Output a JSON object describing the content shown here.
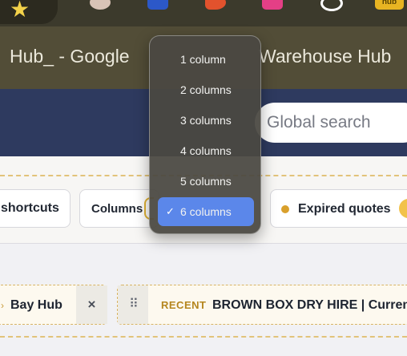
{
  "toolbar": {
    "bookmark_icon": "star-icon",
    "extensions": [
      "avatar-icon",
      "puzzle-icon",
      "rocket-icon",
      "pink-app-icon",
      "openai-icon",
      "hub-icon"
    ],
    "hub_badge": "hub"
  },
  "titlebar": {
    "title_left": "Hub_ - Google",
    "title_right": "Warehouse Hub"
  },
  "header": {
    "search_placeholder": "Global search"
  },
  "filters": {
    "shortcuts_label": "shortcuts",
    "columns_label": "Columns",
    "expired_label": "Expired quotes",
    "expired_color": "#d9a02c"
  },
  "cards": {
    "left_name": "Bay Hub",
    "left_close": "×",
    "right_tag": "RECENT",
    "right_title": "BROWN BOX DRY HIRE | Curren",
    "grip_glyph": "⠿"
  },
  "menu": {
    "check_glyph": "✓",
    "selected_color": "#5b87ea",
    "items": [
      {
        "label": "1 column"
      },
      {
        "label": "2 columns"
      },
      {
        "label": "3 columns"
      },
      {
        "label": "4 columns"
      },
      {
        "label": "5 columns"
      },
      {
        "label": "6 columns",
        "selected": true
      }
    ]
  }
}
